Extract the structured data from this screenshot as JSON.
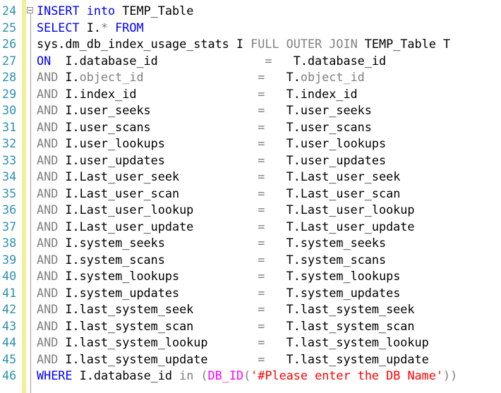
{
  "editor": {
    "lines": [
      {
        "n": "24",
        "parts": [
          {
            "t": "INSERT",
            "c": "kw"
          },
          {
            "t": " ",
            "c": "ident"
          },
          {
            "t": "into",
            "c": "kw"
          },
          {
            "t": " TEMP_Table",
            "c": "ident"
          }
        ]
      },
      {
        "n": "25",
        "parts": [
          {
            "t": "SELECT",
            "c": "kw"
          },
          {
            "t": " I.",
            "c": "ident"
          },
          {
            "t": "*",
            "c": "op"
          },
          {
            "t": " ",
            "c": "ident"
          },
          {
            "t": "FROM",
            "c": "kw"
          }
        ]
      },
      {
        "n": "26",
        "parts": [
          {
            "t": "sys.dm_db_index_usage_stats I ",
            "c": "ident"
          },
          {
            "t": "FULL",
            "c": "op"
          },
          {
            "t": " ",
            "c": "ident"
          },
          {
            "t": "OUTER",
            "c": "op"
          },
          {
            "t": " ",
            "c": "ident"
          },
          {
            "t": "JOIN",
            "c": "op"
          },
          {
            "t": " TEMP_Table T",
            "c": "ident"
          }
        ]
      },
      {
        "n": "27",
        "parts": [
          {
            "t": "ON",
            "c": "kw"
          },
          {
            "t": "  I.database_id",
            "c": "ident"
          },
          {
            "t": "               =   ",
            "c": "op"
          },
          {
            "t": "T.database_id",
            "c": "ident"
          }
        ]
      },
      {
        "n": "28",
        "parts": [
          {
            "t": "AND",
            "c": "op"
          },
          {
            "t": " I.",
            "c": "ident"
          },
          {
            "t": "object_id",
            "c": "grey"
          },
          {
            "t": "                =   ",
            "c": "op"
          },
          {
            "t": "T.",
            "c": "ident"
          },
          {
            "t": "object_id",
            "c": "grey"
          }
        ]
      },
      {
        "n": "29",
        "parts": [
          {
            "t": "AND",
            "c": "op"
          },
          {
            "t": " I.index_id",
            "c": "ident"
          },
          {
            "t": "                 =   ",
            "c": "op"
          },
          {
            "t": "T.index_id",
            "c": "ident"
          }
        ]
      },
      {
        "n": "30",
        "parts": [
          {
            "t": "AND",
            "c": "op"
          },
          {
            "t": " I.user_seeks",
            "c": "ident"
          },
          {
            "t": "               =   ",
            "c": "op"
          },
          {
            "t": "T.user_seeks",
            "c": "ident"
          }
        ]
      },
      {
        "n": "31",
        "parts": [
          {
            "t": "AND",
            "c": "op"
          },
          {
            "t": " I.user_scans",
            "c": "ident"
          },
          {
            "t": "               =   ",
            "c": "op"
          },
          {
            "t": "T.user_scans",
            "c": "ident"
          }
        ]
      },
      {
        "n": "32",
        "parts": [
          {
            "t": "AND",
            "c": "op"
          },
          {
            "t": " I.user_lookups",
            "c": "ident"
          },
          {
            "t": "             =   ",
            "c": "op"
          },
          {
            "t": "T.user_lookups",
            "c": "ident"
          }
        ]
      },
      {
        "n": "33",
        "parts": [
          {
            "t": "AND",
            "c": "op"
          },
          {
            "t": " I.user_updates",
            "c": "ident"
          },
          {
            "t": "             =   ",
            "c": "op"
          },
          {
            "t": "T.user_updates",
            "c": "ident"
          }
        ]
      },
      {
        "n": "34",
        "parts": [
          {
            "t": "AND",
            "c": "op"
          },
          {
            "t": " I.Last_user_seek",
            "c": "ident"
          },
          {
            "t": "           =   ",
            "c": "op"
          },
          {
            "t": "T.Last_user_seek",
            "c": "ident"
          }
        ]
      },
      {
        "n": "35",
        "parts": [
          {
            "t": "AND",
            "c": "op"
          },
          {
            "t": " I.Last_user_scan",
            "c": "ident"
          },
          {
            "t": "           =   ",
            "c": "op"
          },
          {
            "t": "T.Last_user_scan",
            "c": "ident"
          }
        ]
      },
      {
        "n": "36",
        "parts": [
          {
            "t": "AND",
            "c": "op"
          },
          {
            "t": " I.Last_user_lookup",
            "c": "ident"
          },
          {
            "t": "         =   ",
            "c": "op"
          },
          {
            "t": "T.Last_user_lookup",
            "c": "ident"
          }
        ]
      },
      {
        "n": "37",
        "parts": [
          {
            "t": "AND",
            "c": "op"
          },
          {
            "t": " I.Last_user_update",
            "c": "ident"
          },
          {
            "t": "         =   ",
            "c": "op"
          },
          {
            "t": "T.Last_user_update",
            "c": "ident"
          }
        ]
      },
      {
        "n": "38",
        "parts": [
          {
            "t": "AND",
            "c": "op"
          },
          {
            "t": " I.system_seeks",
            "c": "ident"
          },
          {
            "t": "             =   ",
            "c": "op"
          },
          {
            "t": "T.system_seeks",
            "c": "ident"
          }
        ]
      },
      {
        "n": "39",
        "parts": [
          {
            "t": "AND",
            "c": "op"
          },
          {
            "t": " I.system_scans",
            "c": "ident"
          },
          {
            "t": "             =   ",
            "c": "op"
          },
          {
            "t": "T.system_scans",
            "c": "ident"
          }
        ]
      },
      {
        "n": "40",
        "parts": [
          {
            "t": "AND",
            "c": "op"
          },
          {
            "t": " I.system_lookups",
            "c": "ident"
          },
          {
            "t": "           =   ",
            "c": "op"
          },
          {
            "t": "T.system_lookups",
            "c": "ident"
          }
        ]
      },
      {
        "n": "41",
        "parts": [
          {
            "t": "AND",
            "c": "op"
          },
          {
            "t": " I.system_updates",
            "c": "ident"
          },
          {
            "t": "           =   ",
            "c": "op"
          },
          {
            "t": "T.system_updates",
            "c": "ident"
          }
        ]
      },
      {
        "n": "42",
        "parts": [
          {
            "t": "AND",
            "c": "op"
          },
          {
            "t": " I.last_system_seek",
            "c": "ident"
          },
          {
            "t": "         =   ",
            "c": "op"
          },
          {
            "t": "T.last_system_seek",
            "c": "ident"
          }
        ]
      },
      {
        "n": "43",
        "parts": [
          {
            "t": "AND",
            "c": "op"
          },
          {
            "t": " I.last_system_scan",
            "c": "ident"
          },
          {
            "t": "         =   ",
            "c": "op"
          },
          {
            "t": "T.last_system_scan",
            "c": "ident"
          }
        ]
      },
      {
        "n": "44",
        "parts": [
          {
            "t": "AND",
            "c": "op"
          },
          {
            "t": " I.last_system_lookup",
            "c": "ident"
          },
          {
            "t": "       =   ",
            "c": "op"
          },
          {
            "t": "T.last_system_lookup",
            "c": "ident"
          }
        ]
      },
      {
        "n": "45",
        "parts": [
          {
            "t": "AND",
            "c": "op"
          },
          {
            "t": " I.last_system_update",
            "c": "ident"
          },
          {
            "t": "       =   ",
            "c": "op"
          },
          {
            "t": "T.last_system_update",
            "c": "ident"
          }
        ]
      },
      {
        "n": "46",
        "parts": [
          {
            "t": "WHERE",
            "c": "kw"
          },
          {
            "t": " I.database_id ",
            "c": "ident"
          },
          {
            "t": "in",
            "c": "op"
          },
          {
            "t": " ",
            "c": "ident"
          },
          {
            "t": "(",
            "c": "op"
          },
          {
            "t": "DB_ID",
            "c": "fn"
          },
          {
            "t": "(",
            "c": "op"
          },
          {
            "t": "'#Please enter the DB Name'",
            "c": "str"
          },
          {
            "t": "))",
            "c": "op"
          }
        ]
      }
    ]
  },
  "colors": {
    "keyword": "#0000ff",
    "operator": "#808080",
    "string": "#ff0000",
    "function": "#ff00ff",
    "line_number": "#2b91af",
    "change_bar": "#f3ef95"
  }
}
